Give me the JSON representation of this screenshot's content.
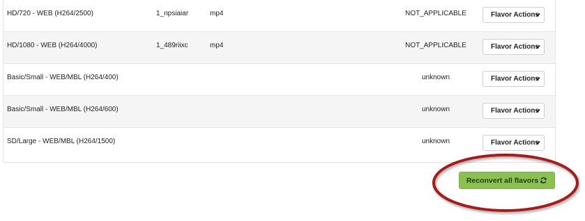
{
  "flavors": [
    {
      "name": "HD/720 - WEB (H264/2500)",
      "asset_id": "1_npsiaiar",
      "file_ext": "mp4",
      "status": "NOT_APPLICABLE",
      "action_label": "Flavor Actions"
    },
    {
      "name": "HD/1080 - WEB (H264/4000)",
      "asset_id": "1_489riixc",
      "file_ext": "mp4",
      "status": "NOT_APPLICABLE",
      "action_label": "Flavor Actions"
    },
    {
      "name": "Basic/Small - WEB/MBL (H264/400)",
      "asset_id": "",
      "file_ext": "",
      "status": "unknown",
      "action_label": "Flavor Actions"
    },
    {
      "name": "Basic/Small - WEB/MBL (H264/600)",
      "asset_id": "",
      "file_ext": "",
      "status": "unknown",
      "action_label": "Flavor Actions"
    },
    {
      "name": "SD/Large - WEB/MBL (H264/1500)",
      "asset_id": "",
      "file_ext": "",
      "status": "unknown",
      "action_label": "Flavor Actions"
    }
  ],
  "reconvert_button": {
    "label": "Reconvert all flavors",
    "icon": "refresh-icon"
  },
  "annotation": {
    "shape": "ellipse",
    "color": "#a51d1d"
  },
  "colors": {
    "reconvert_bg": "#8cc152",
    "row_alt_bg": "#f5f5f5",
    "annotation_red": "#a51d1d"
  }
}
